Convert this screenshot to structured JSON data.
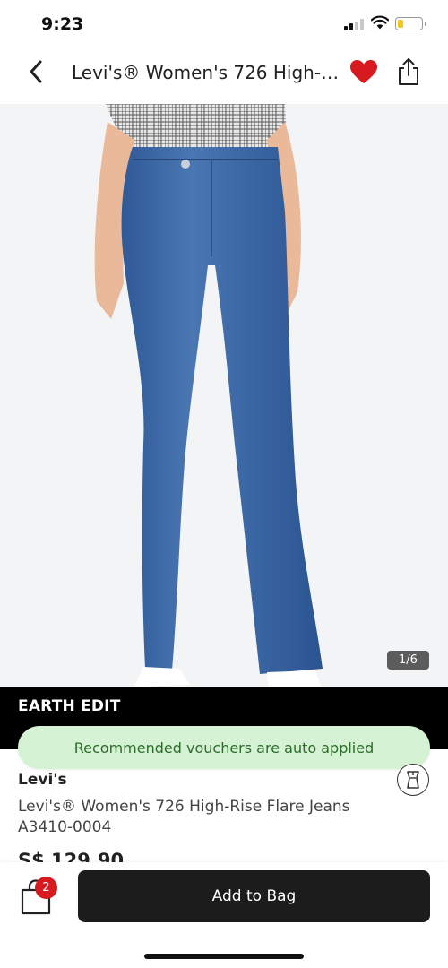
{
  "status_bar": {
    "time": "9:23",
    "signal_bars_active": 2,
    "signal_bars_total": 4,
    "battery_level": 0.2,
    "battery_color": "#f5c518"
  },
  "nav": {
    "title": "Levi's® Women's 726 High-Rise Flare Jeans",
    "back_icon": "chevron-left-icon",
    "wishlist_icon": "heart-icon",
    "wishlist_color": "#d71920",
    "share_icon": "share-icon"
  },
  "gallery": {
    "current": 1,
    "total": 6,
    "indicator": "1/6"
  },
  "banner": {
    "label": "EARTH EDIT"
  },
  "voucher": {
    "text": "Recommended vouchers are auto applied"
  },
  "product": {
    "brand": "Levi's",
    "name": "Levi's® Women's 726 High-Rise Flare Jeans A3410-0004",
    "price": "S$ 129.90",
    "size_guide_icon": "size-guide-icon"
  },
  "bottom_bar": {
    "bag_icon": "shopping-bag-icon",
    "bag_count": "2",
    "add_to_bag_label": "Add to Bag"
  }
}
